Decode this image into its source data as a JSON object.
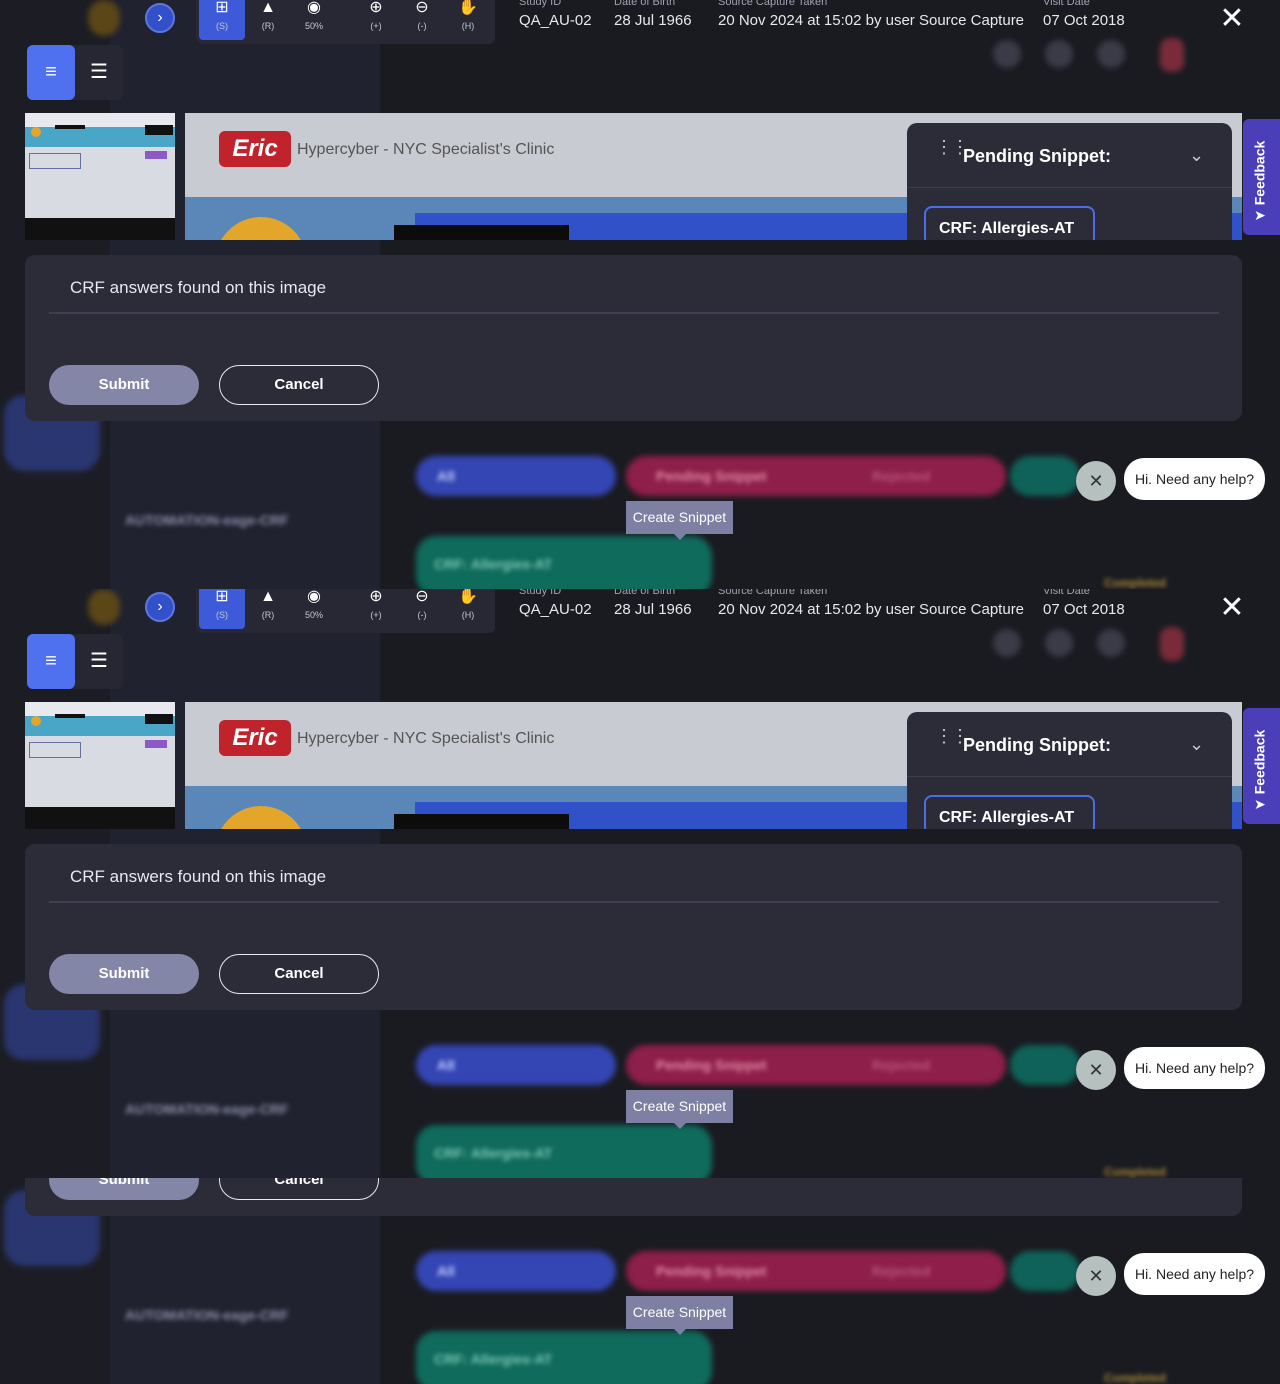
{
  "toolbar": {
    "tools": [
      {
        "name": "select-tool",
        "key": "(S)",
        "icon": "crop-icon"
      },
      {
        "name": "redact-tool",
        "key": "(R)",
        "icon": "stamp-icon"
      },
      {
        "name": "opacity-tool",
        "key": "50%",
        "icon": "drop-icon"
      },
      {
        "name": "zoom-in-tool",
        "key": "(+)",
        "icon": "zoom-in-icon"
      },
      {
        "name": "zoom-out-tool",
        "key": "(-)",
        "icon": "zoom-out-icon"
      },
      {
        "name": "pan-tool",
        "key": "(H)",
        "icon": "hand-icon"
      }
    ]
  },
  "study": {
    "study_id_label": "Study ID",
    "study_id": "QA_AU-02",
    "dob_label": "Date of Birth",
    "dob": "28 Jul 1966",
    "capture_label": "Source Capture Taken",
    "capture": "20 Nov 2024 at 15:02 by user Source Capture",
    "visit_label": "Visit Date",
    "visit": "07 Oct 2018"
  },
  "preview": {
    "logo_text": "Eric",
    "clinic_name": "Hypercyber - NYC Specialist's Clinic"
  },
  "pending": {
    "title": "Pending Snippet:",
    "chip": "CRF: Allergies-AT"
  },
  "feedback": {
    "label": "Feedback"
  },
  "form": {
    "label": "CRF answers found on this image",
    "submit": "Submit",
    "cancel": "Cancel"
  },
  "help": {
    "bubble": "Hi. Need any help?"
  },
  "tooltip": {
    "label": "Create Snippet"
  },
  "backdrop": {
    "filter_all": "All",
    "filter_pending": "Pending Snippet",
    "filter_rejected": "Rejected",
    "crf_item": "CRF: Allergies-AT",
    "side_title": "AUTOMATION-eage-CRF",
    "completed": "Completed"
  },
  "colors": {
    "accent": "#4f71f0",
    "panel": "#2b2c38",
    "background": "#1a1b21",
    "submit": "#8386a6",
    "feedback": "#4a3fb8"
  }
}
